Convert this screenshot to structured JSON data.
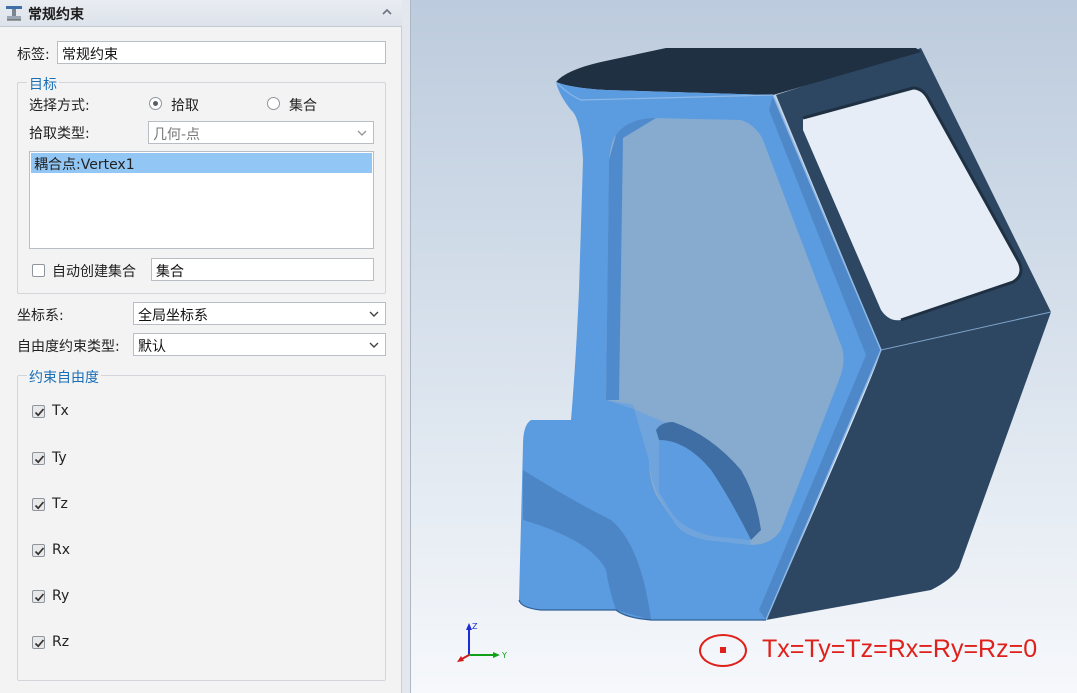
{
  "panel": {
    "title": "常规约束",
    "label_caption": "标签:",
    "label_value": "常规约束",
    "target": {
      "group_title": "目标",
      "selection_mode_caption": "选择方式:",
      "mode_pick": "拾取",
      "mode_set": "集合",
      "selected_mode": "拾取",
      "pick_type_caption": "拾取类型:",
      "pick_type_value": "几何-点",
      "list_items": [
        "耦合点:Vertex1"
      ],
      "auto_create_label": "自动创建集合",
      "auto_create_checked": false,
      "set_name_value": "集合"
    },
    "coord_caption": "坐标系:",
    "coord_value": "全局坐标系",
    "dof_type_caption": "自由度约束类型:",
    "dof_type_value": "默认",
    "dof": {
      "group_title": "约束自由度",
      "items": [
        {
          "label": "Tx",
          "checked": true
        },
        {
          "label": "Ty",
          "checked": true
        },
        {
          "label": "Tz",
          "checked": true
        },
        {
          "label": "Rx",
          "checked": true
        },
        {
          "label": "Ry",
          "checked": true
        },
        {
          "label": "Rz",
          "checked": true
        }
      ]
    }
  },
  "viewport": {
    "triad": {
      "z": "Z",
      "y": "Y"
    },
    "annotation": "Tx=Ty=Tz=Rx=Ry=Rz=0"
  },
  "colors": {
    "accent": "#1b6fb7",
    "selection": "#91c6f5",
    "annotation": "#e0201b",
    "model_light": "#5b9be0",
    "model_dark": "#2c4660"
  }
}
